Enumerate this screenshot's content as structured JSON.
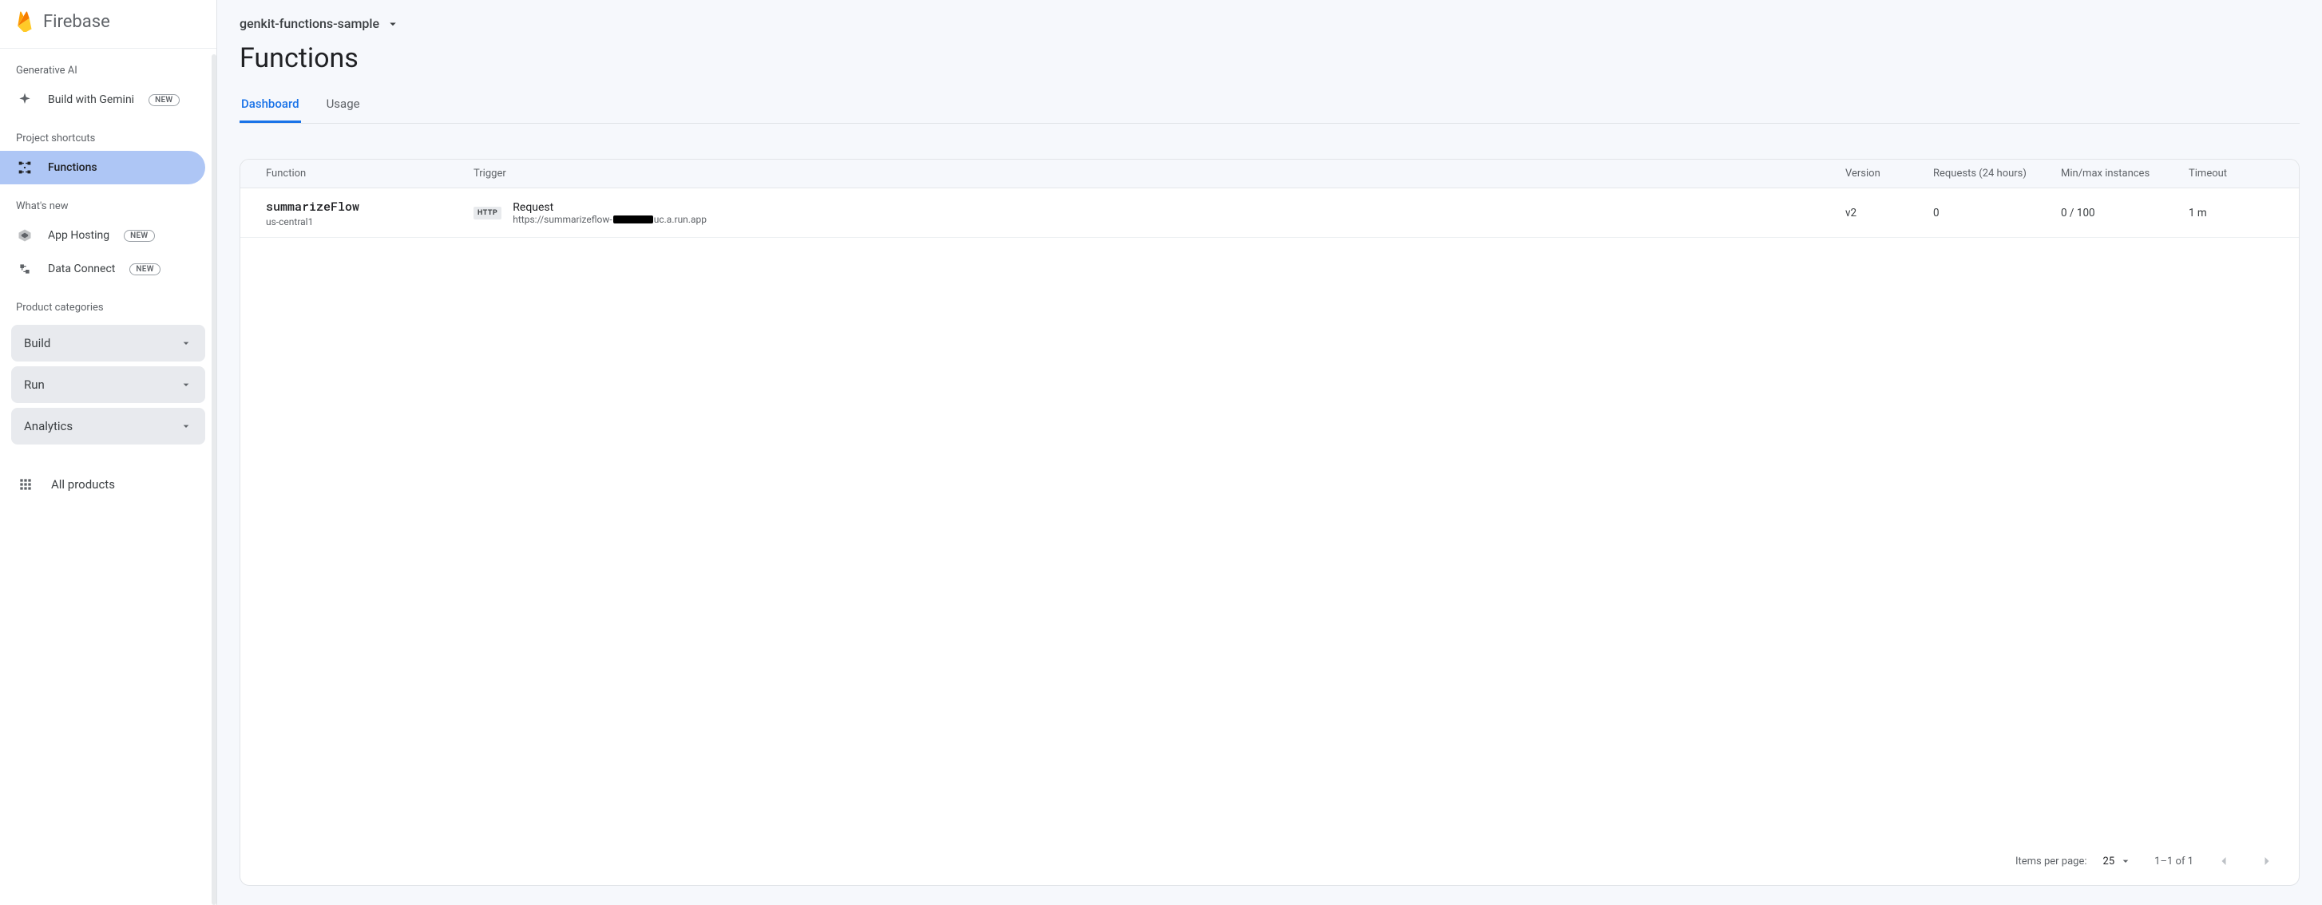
{
  "logo_text": "Firebase",
  "project_name": "genkit-functions-sample",
  "page_title": "Functions",
  "tabs": {
    "dashboard": "Dashboard",
    "usage": "Usage"
  },
  "sidebar": {
    "section_generative": "Generative AI",
    "gemini_label": "Build with Gemini",
    "gemini_badge": "NEW",
    "section_shortcuts": "Project shortcuts",
    "functions_label": "Functions",
    "section_new": "What's new",
    "app_hosting_label": "App Hosting",
    "app_hosting_badge": "NEW",
    "data_connect_label": "Data Connect",
    "data_connect_badge": "NEW",
    "section_categories": "Product categories",
    "cat_build": "Build",
    "cat_run": "Run",
    "cat_analytics": "Analytics",
    "all_products": "All products"
  },
  "table": {
    "col_function": "Function",
    "col_trigger": "Trigger",
    "col_version": "Version",
    "col_requests": "Requests (24 hours)",
    "col_minmax": "Min/max instances",
    "col_timeout": "Timeout",
    "rows": [
      {
        "name": "summarizeFlow",
        "region": "us-central1",
        "trigger_badge": "HTTP",
        "trigger_title": "Request",
        "trigger_url_prefix": "https://summarizeflow-",
        "trigger_url_suffix": "uc.a.run.app",
        "version": "v2",
        "requests": "0",
        "minmax": "0 / 100",
        "timeout": "1 m"
      }
    ],
    "pager": {
      "items_per_page_label": "Items per page:",
      "items_per_page_value": "25",
      "range": "1–1 of 1"
    }
  }
}
